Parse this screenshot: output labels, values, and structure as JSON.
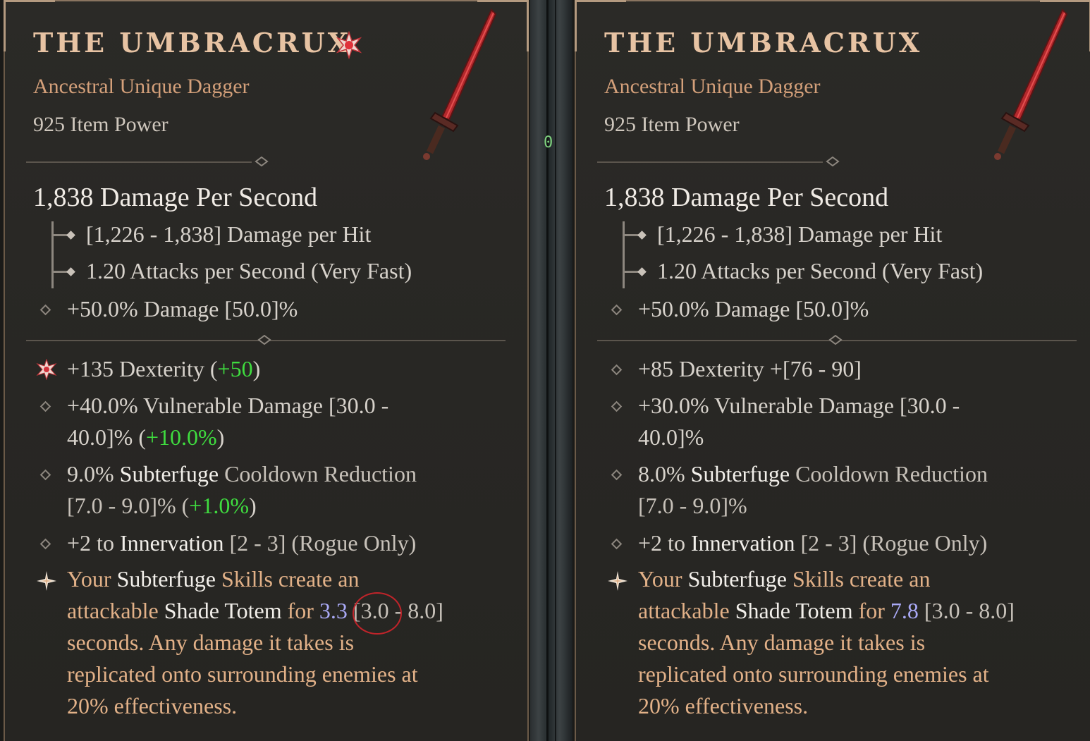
{
  "left": {
    "title": "THE UMBRACRUX",
    "subtitle": "Ancestral Unique Dagger",
    "item_power": "925 Item Power",
    "dps": "1,838 Damage Per Second",
    "damage_per_hit": "[1,226 - 1,838] Damage per Hit",
    "attacks_per_second": "1.20 Attacks per Second (Very Fast)",
    "implicit": "+50.0% Damage [50.0]%",
    "dex": {
      "base": "+135 Dexterity (",
      "bonus": "+50",
      "end": ")"
    },
    "vuln": {
      "text": "+40.0% Vulnerable Damage [30.0 -",
      "text2": "40.0]% (",
      "bonus": "+10.0%",
      "end": ")"
    },
    "cdr": {
      "val": "9.0% ",
      "skill": "Subterfuge",
      "rest": " Cooldown Reduction",
      "line2": "[7.0 - 9.0]% (",
      "bonus": "+1.0%",
      "end": ")"
    },
    "innervation": {
      "a": "+2 to ",
      "skill": "Innervation",
      "b": " [2 - 3] (Rogue Only)"
    },
    "unique": {
      "l1a": "Your ",
      "l1b": "Subterfuge",
      "l1c": " Skills create an",
      "l2a": "attackable ",
      "l2b": "Shade Totem",
      "l2c": " for ",
      "l2val": "3.3",
      "l2range": " [3.0 - 8.0]",
      "l3": "seconds. Any damage it takes is",
      "l4": "replicated onto surrounding enemies at",
      "l5": "20% effectiveness."
    }
  },
  "right": {
    "title": "THE UMBRACRUX",
    "subtitle": "Ancestral Unique Dagger",
    "item_power": "925 Item Power",
    "dps": "1,838 Damage Per Second",
    "damage_per_hit": "[1,226 - 1,838] Damage per Hit",
    "attacks_per_second": "1.20 Attacks per Second (Very Fast)",
    "implicit": "+50.0% Damage [50.0]%",
    "dex": "+85 Dexterity +[76 - 90]",
    "vuln": {
      "text": "+30.0% Vulnerable Damage [30.0 -",
      "text2": "40.0]%"
    },
    "cdr": {
      "val": "8.0% ",
      "skill": "Subterfuge",
      "rest": " Cooldown Reduction",
      "line2": "[7.0 - 9.0]%"
    },
    "innervation": {
      "a": "+2 to ",
      "skill": "Innervation",
      "b": " [2 - 3] (Rogue Only)"
    },
    "unique": {
      "l1a": "Your ",
      "l1b": "Subterfuge",
      "l1c": " Skills create an",
      "l2a": "attackable ",
      "l2b": "Shade Totem",
      "l2c": " for ",
      "l2val": "7.8",
      "l2range": " [3.0 - 8.0]",
      "l3": "seconds. Any damage it takes is",
      "l4": "replicated onto surrounding enemies at",
      "l5": "20% effectiveness."
    }
  },
  "separator_counter": "0"
}
